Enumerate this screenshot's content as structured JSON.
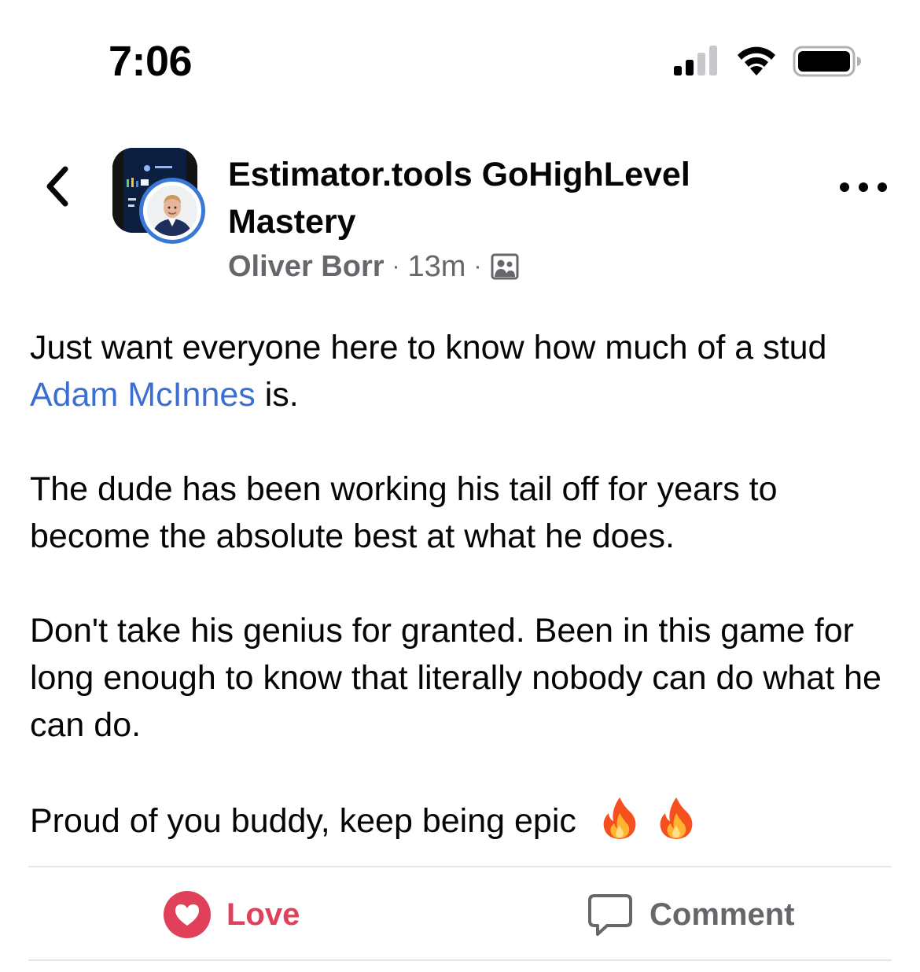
{
  "status_bar": {
    "time": "7:06",
    "signal_icon": "cellular-signal-icon",
    "wifi_icon": "wifi-icon",
    "battery_icon": "battery-icon"
  },
  "header": {
    "back_icon": "chevron-left-icon",
    "group_name": "Estimator.tools GoHighLevel Mastery",
    "author": "Oliver Borr",
    "separator": "·",
    "time_ago": "13m",
    "audience_icon": "group-members-icon",
    "more_icon": "more-horizontal-icon"
  },
  "post": {
    "p1_before": "Just want everyone here to know how much of a stud ",
    "mention": "Adam McInnes",
    "p1_after": " is.",
    "p2": "The dude has been working his tail off for years to become the absolute best at what he does.",
    "p3": "Don't take his genius for granted. Been in this game for long enough to know that literally nobody can do what he can do.",
    "p4": "Proud of you buddy, keep being epic",
    "emojis": [
      "fire-emoji",
      "fire-emoji"
    ]
  },
  "actions": {
    "love_label": "Love",
    "comment_label": "Comment"
  },
  "colors": {
    "text": "#050505",
    "secondary": "#65676b",
    "link": "#3a6fd1",
    "love": "#e0405a",
    "avatar_ring": "#3a78d6",
    "divider": "#e4e6eb"
  }
}
